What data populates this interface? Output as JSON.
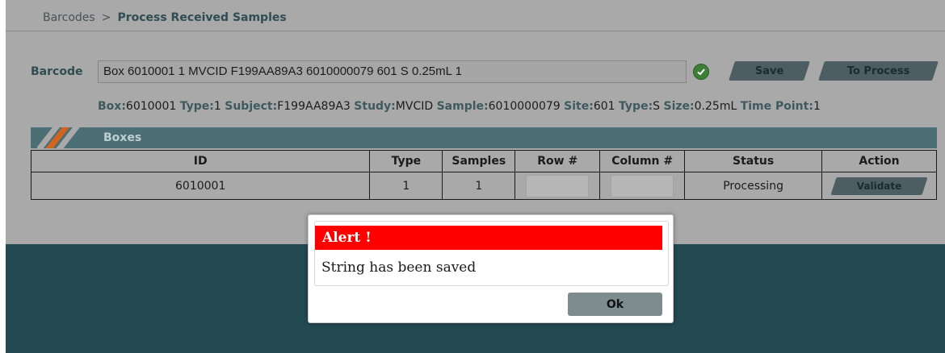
{
  "breadcrumb": {
    "parent": "Barcodes",
    "separator": ">",
    "current": "Process Received Samples"
  },
  "barcode": {
    "label": "Barcode",
    "value": "Box 6010001 1  MVCID F199AA89A3 6010000079 601 S 0.25mL 1",
    "status_icon": "check-circle-icon"
  },
  "buttons": {
    "save": "Save",
    "to_process": "To Process"
  },
  "summary": [
    {
      "key": "Box:",
      "value": "6010001"
    },
    {
      "key": "Type:",
      "value": "1"
    },
    {
      "key": "Subject:",
      "value": "F199AA89A3"
    },
    {
      "key": "Study:",
      "value": "MVCID"
    },
    {
      "key": "Sample:",
      "value": "6010000079"
    },
    {
      "key": "Site:",
      "value": "601"
    },
    {
      "key": "Type:",
      "value": "S"
    },
    {
      "key": "Size:",
      "value": "0.25mL"
    },
    {
      "key": "Time Point:",
      "value": "1"
    }
  ],
  "boxes": {
    "title": "Boxes",
    "columns": [
      "ID",
      "Type",
      "Samples",
      "Row #",
      "Column #",
      "Status",
      "Action"
    ],
    "rows": [
      {
        "id": "6010001",
        "type": "1",
        "samples": "1",
        "row": "",
        "column": "",
        "status": "Processing",
        "action": "Validate"
      }
    ]
  },
  "modal": {
    "title": "Alert !",
    "message": "String has been saved",
    "ok_label": "Ok"
  },
  "colors": {
    "alert_red": "#ff0000",
    "header_teal": "#4c6f75",
    "stripe_orange": "#d2651e",
    "check_green": "#3d7f36"
  }
}
